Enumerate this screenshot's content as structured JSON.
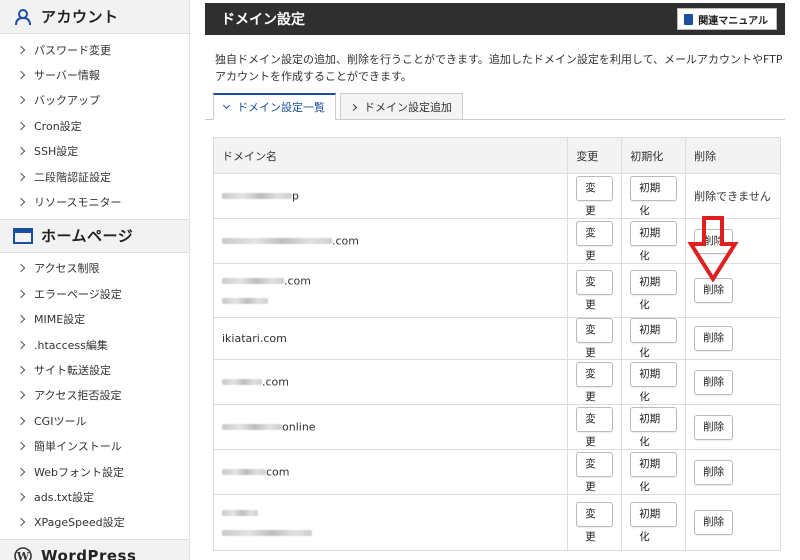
{
  "sidebar": {
    "account": {
      "title": "アカウント",
      "icon": "user-icon",
      "items": [
        "パスワード変更",
        "サーバー情報",
        "バックアップ",
        "Cron設定",
        "SSH設定",
        "二段階認証設定",
        "リソースモニター"
      ]
    },
    "homepage": {
      "title": "ホームページ",
      "icon": "window-icon",
      "items": [
        "アクセス制限",
        "エラーページ設定",
        "MIME設定",
        ".htaccess編集",
        "サイト転送設定",
        "アクセス拒否設定",
        "CGIツール",
        "簡単インストール",
        "Webフォント設定",
        "ads.txt設定",
        "XPageSpeed設定"
      ]
    },
    "wordpress": {
      "title": "WordPress",
      "icon": "wordpress-icon"
    }
  },
  "main": {
    "title": "ドメイン設定",
    "manual_label": "関連マニュアル",
    "description": "独自ドメイン設定の追加、削除を行うことができます。追加したドメイン設定を利用して、メールアカウントやFTPアカウントを作成することができます。",
    "tabs": [
      {
        "label": "ドメイン設定一覧",
        "active": true
      },
      {
        "label": "ドメイン設定追加",
        "active": false
      }
    ]
  },
  "table": {
    "headers": {
      "domain": "ドメイン名",
      "change": "変更",
      "init": "初期化",
      "delete": "削除"
    },
    "change_label": "変更",
    "init_label": "初期化",
    "delete_label": "削除",
    "cannot_delete_label": "削除できません",
    "rows": [
      {
        "tld": "p"
      },
      {
        "tld": ".com"
      },
      {
        "tld": ".com"
      },
      {
        "domain": "ikiatari.com"
      },
      {
        "tld": ".com"
      },
      {
        "tld": "online"
      },
      {
        "tld": "com"
      },
      {
        "tld": ""
      }
    ]
  },
  "colors": {
    "accent": "#1a4fa0",
    "titlebar": "#2f2f2f",
    "annotation_arrow": "#e02020"
  }
}
